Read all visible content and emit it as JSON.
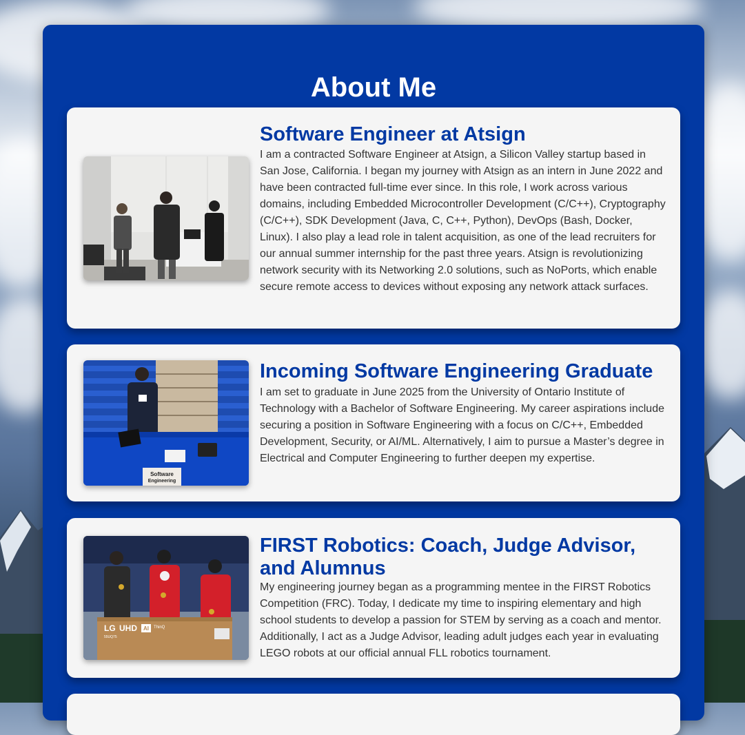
{
  "page": {
    "title": "About Me"
  },
  "cards": [
    {
      "heading": "Software Engineer at Atsign",
      "text": "I am a contracted Software Engineer at Atsign, a Silicon Valley startup based in San Jose, California. I began my journey with Atsign as an intern in June 2022 and have been contracted full-time ever since. In this role, I work across various domains, including Embedded Microcontroller Development (C/C++), Cryptography (C/C++), SDK Development (Java, C, C++, Python), DevOps (Bash, Docker, Linux). I also play a lead role in talent acquisition, as one of the lead recruiters for our annual summer internship for the past three years. Atsign is revolutionizing network security with its Networking 2.0 solutions, such as NoPorts, which enable secure remote access to devices without exposing any network attack surfaces."
    },
    {
      "heading": "Incoming Software Engineering Graduate",
      "text": "I am set to graduate in June 2025 from the University of Ontario Institute of Technology with a Bachelor of Software Engineering. My career aspirations include securing a position in Software Engineering with a focus on C/C++, Embedded Development, Security, or AI/ML. Alternatively, I aim to pursue a Master’s degree in Electrical and Computer Engineering to further deepen my expertise.",
      "photo_sign": [
        "Software",
        "Engineering"
      ]
    },
    {
      "heading": "FIRST Robotics: Coach, Judge Advisor, and Alumnus",
      "text": "My engineering journey began as a programming mentee in the FIRST Robotics Competition (FRC). Today, I dedicate my time to inspiring elementary and high school students to develop a passion for STEM by serving as a coach and mentor. Additionally, I act as a Judge Advisor, leading adult judges each year in evaluating LEGO robots at our official annual FLL robotics tournament.",
      "photo_box": {
        "brand": "LG",
        "line": "UHD",
        "badge": "AI",
        "model": "ThinQ",
        "code": "55UQ75"
      }
    }
  ],
  "colors": {
    "panel": "#0239a3",
    "card": "#f5f5f5",
    "heading": "#0239a3",
    "text": "#333333"
  }
}
